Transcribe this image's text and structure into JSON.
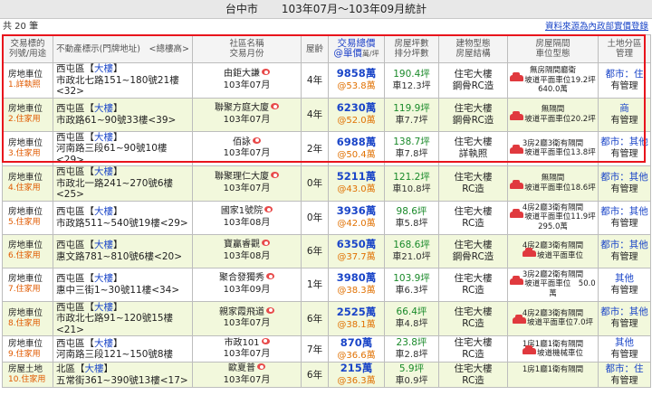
{
  "title": {
    "city": "台中市",
    "period": "103年07月～103年09月統計"
  },
  "count_text": "共 20 筆",
  "source_link": "資料來源為內政部實價登錄",
  "headers": {
    "c1": [
      "交易標的",
      "列號/用途"
    ],
    "c2": "不動產標示(門牌地址)　<總樓高>",
    "c3": [
      "社區名稱",
      "交易月份"
    ],
    "c4": "屋齡",
    "c5": [
      "交易總價",
      "@單價",
      "萬/坪"
    ],
    "c6": [
      "房屋坪數",
      "排分坪數"
    ],
    "c7": [
      "建物型態",
      "房屋結構"
    ],
    "c8": [
      "房屋隔間",
      "車位型態"
    ],
    "c9": [
      "土地分區",
      "管理"
    ]
  },
  "rows": [
    {
      "no": "1.",
      "type": "房地車位",
      "use": "詳執照",
      "addr1": "西屯區【",
      "addr_big": "大樓",
      "addr1b": "】",
      "addr2": "市政北七路151~180號21樓",
      "addr3": "<32>",
      "community": "由鉅大謙",
      "month": "103年07月",
      "age": "4年",
      "price": "9858萬",
      "unit": "@53.8萬",
      "area": "190.4坪",
      "area2": "車12.3坪",
      "build1": "住宅大樓",
      "build2": "鋼骨RC造",
      "room1": "無房隔間廳衛",
      "room2": "坡道平面車位19.2坪",
      "room3": "640.0萬",
      "car": true,
      "zone1": "都市：住",
      "zone2": "有管理"
    },
    {
      "no": "2.",
      "type": "房地車位",
      "use": "住家用",
      "addr1": "西屯區【",
      "addr_big": "大樓",
      "addr1b": "】",
      "addr2": "市政路61~90號33樓<39>",
      "addr3": "",
      "community": "聯聚方庭大廈",
      "month": "103年07月",
      "age": "4年",
      "price": "6230萬",
      "unit": "@52.0萬",
      "area": "119.9坪",
      "area2": "車7.7坪",
      "build1": "住宅大樓",
      "build2": "鋼骨RC造",
      "room1": "無隔間",
      "room2": "坡道平面車位20.2坪",
      "room3": "",
      "car": true,
      "zone1": "商",
      "zone2": "有管理"
    },
    {
      "no": "3.",
      "type": "房地車位",
      "use": "住家用",
      "addr1": "西屯區【",
      "addr_big": "大樓",
      "addr1b": "】",
      "addr2": "河南路三段61~90號10樓",
      "addr3": "<29>",
      "community": "佰詠",
      "month": "103年07月",
      "age": "2年",
      "price": "6988萬",
      "unit": "@50.4萬",
      "area": "138.7坪",
      "area2": "車7.8坪",
      "build1": "住宅大樓",
      "build2": "詳執照",
      "room1": "3房2廳3衛有隔間",
      "room2": "坡道平面車位13.8坪",
      "room3": "",
      "car": true,
      "zone1": "都市：其他",
      "zone2": "有管理"
    },
    {
      "no": "4.",
      "type": "房地車位",
      "use": "住家用",
      "addr1": "西屯區【",
      "addr_big": "大樓",
      "addr1b": "】",
      "addr2": "市政北一路241~270號6樓",
      "addr3": "<25>",
      "community": "聯聚理仁大廈",
      "month": "103年07月",
      "age": "0年",
      "price": "5211萬",
      "unit": "@43.0萬",
      "area": "121.2坪",
      "area2": "車10.8坪",
      "build1": "住宅大樓",
      "build2": "RC造",
      "room1": "無隔間",
      "room2": "坡道平面車位18.6坪",
      "room3": "",
      "car": true,
      "zone1": "都市：其他",
      "zone2": "有管理"
    },
    {
      "no": "5.",
      "type": "房地車位",
      "use": "住家用",
      "addr1": "西屯區【",
      "addr_big": "大樓",
      "addr1b": "】",
      "addr2": "市政路511~540號19樓<29>",
      "addr3": "",
      "community": "國家1號院",
      "month": "103年08月",
      "age": "0年",
      "price": "3936萬",
      "unit": "@42.0萬",
      "area": "98.6坪",
      "area2": "車5.8坪",
      "build1": "住宅大樓",
      "build2": "RC造",
      "room1": "4房2廳3衛有隔間",
      "room2": "坡道平面車位11.9坪",
      "room3": "295.0萬",
      "car": true,
      "zone1": "都市：其他",
      "zone2": "有管理"
    },
    {
      "no": "6.",
      "type": "房地車位",
      "use": "住家用",
      "addr1": "西屯區【",
      "addr_big": "大樓",
      "addr1b": "】",
      "addr2": "惠文路781~810號6樓<20>",
      "addr3": "",
      "community": "寶贏睿觀",
      "month": "103年08月",
      "age": "6年",
      "price": "6350萬",
      "unit": "@37.7萬",
      "area": "168.6坪",
      "area2": "車21.0坪",
      "build1": "住宅大樓",
      "build2": "鋼骨RC造",
      "room1": "4房2廳3衛有隔間",
      "room2": "坡道平面車位",
      "room3": "",
      "car": true,
      "zone1": "都市：其他",
      "zone2": "有管理"
    },
    {
      "no": "7.",
      "type": "房地車位",
      "use": "住家用",
      "addr1": "西屯區【",
      "addr_big": "大樓",
      "addr1b": "】",
      "addr2": "惠中三街1~30號11樓<34>",
      "addr3": "",
      "community": "聚合發獨秀",
      "month": "103年09月",
      "age": "1年",
      "price": "3980萬",
      "unit": "@38.3萬",
      "area": "103.9坪",
      "area2": "車6.3坪",
      "build1": "住宅大樓",
      "build2": "RC造",
      "room1": "3房2廳2衛有隔間",
      "room2": "坡道平面車位　50.0萬",
      "room3": "",
      "car": true,
      "zone1": "其他",
      "zone2": "有管理"
    },
    {
      "no": "8.",
      "type": "房地車位",
      "use": "住家用",
      "addr1": "西屯區【",
      "addr_big": "大樓",
      "addr1b": "】",
      "addr2": "市政北七路91~120號15樓",
      "addr3": "<21>",
      "community": "親家霞飛道",
      "month": "103年07月",
      "age": "6年",
      "price": "2525萬",
      "unit": "@38.1萬",
      "area": "66.4坪",
      "area2": "車4.8坪",
      "build1": "住宅大樓",
      "build2": "RC造",
      "room1": "4房2廳3衛有隔間",
      "room2": "坡道平面車位7.0坪",
      "room3": "",
      "car": true,
      "zone1": "都市：其他",
      "zone2": "有管理"
    },
    {
      "no": "9.",
      "type": "房地車位",
      "use": "住家用",
      "addr1": "西屯區【",
      "addr_big": "大樓",
      "addr1b": "】",
      "addr2": "河南路三段121~150號8樓",
      "addr3": "",
      "community": "市政101",
      "month": "103年07月",
      "age": "7年",
      "price": "870萬",
      "unit": "@36.6萬",
      "area": "23.8坪",
      "area2": "車2.8坪",
      "build1": "住宅大樓",
      "build2": "RC造",
      "room1": "1房1廳1衛有隔間",
      "room2": "坡道機械車位",
      "room3": "",
      "car": true,
      "zone1": "其他",
      "zone2": "有管理"
    },
    {
      "no": "10.",
      "type": "房屋土地",
      "use": "住家用",
      "addr1": "北區【",
      "addr_big": "大樓",
      "addr1b": "】",
      "addr2": "五常街361~390號13樓<17>",
      "addr3": "",
      "community": "歐夏普",
      "month": "103年07月",
      "age": "6年",
      "price": "215萬",
      "unit": "@36.3萬",
      "area": "5.9坪",
      "area2": "車0.9坪",
      "build1": "住宅大樓",
      "build2": "RC造",
      "room1": "1房1廳1衛有隔間",
      "room2": "",
      "room3": "",
      "car": false,
      "zone1": "都市：住",
      "zone2": "有管理"
    }
  ],
  "colors": {
    "stripe": "#f2f8dc",
    "highlight": "#e8141c",
    "price": "#1a45c8",
    "unit": "#e07000",
    "area": "#1a8a2a"
  }
}
